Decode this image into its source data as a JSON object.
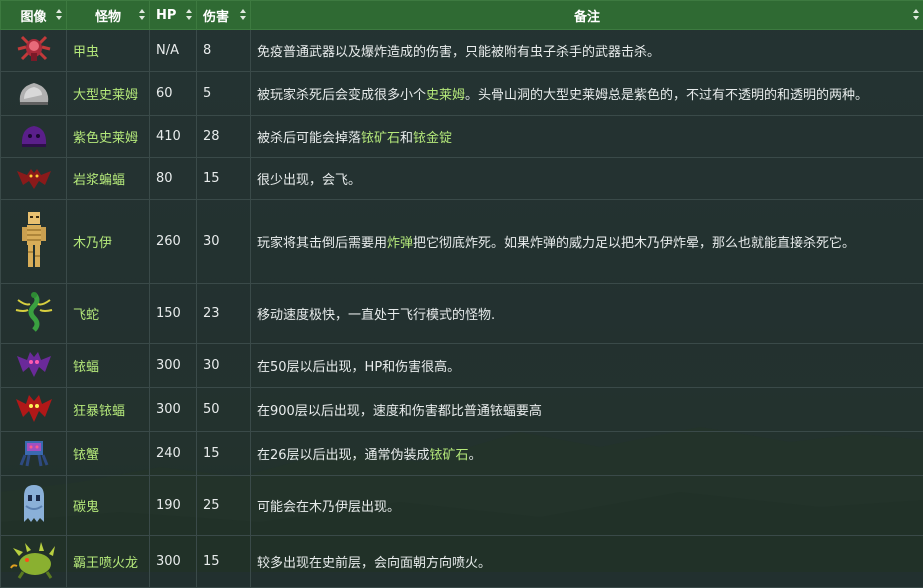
{
  "headers": {
    "image": "图像",
    "monster": "怪物",
    "hp": "HP",
    "damage": "伤害",
    "notes": "备注"
  },
  "rows": [
    {
      "name": "甲虫",
      "hp": "N/A",
      "damage": "8",
      "note": [
        {
          "t": "免疫普通武器以及爆炸造成的伤害，只能被附有虫子杀手的武器击杀。"
        }
      ]
    },
    {
      "name": "大型史莱姆",
      "hp": "60",
      "damage": "5",
      "note": [
        {
          "t": "被玩家杀死后会变成很多小个"
        },
        {
          "t": "史莱姆",
          "link": true
        },
        {
          "t": "。头骨山洞的大型史莱姆总是紫色的，不过有不透明的和透明的两种。"
        }
      ]
    },
    {
      "name": "紫色史莱姆",
      "hp": "410",
      "damage": "28",
      "note": [
        {
          "t": "被杀后可能会掉落"
        },
        {
          "t": "铱矿石",
          "link": true
        },
        {
          "t": "和"
        },
        {
          "t": "铱金锭",
          "link": true
        }
      ]
    },
    {
      "name": "岩浆蝙蝠",
      "hp": "80",
      "damage": "15",
      "note": [
        {
          "t": "很少出现，会飞。"
        }
      ]
    },
    {
      "name": "木乃伊",
      "hp": "260",
      "damage": "30",
      "note": [
        {
          "t": "玩家将其击倒后需要用"
        },
        {
          "t": "炸弹",
          "link": true
        },
        {
          "t": "把它彻底炸死。如果炸弹的威力足以把木乃伊炸晕，那么也就能直接杀死它。"
        }
      ]
    },
    {
      "name": "飞蛇",
      "hp": "150",
      "damage": "23",
      "note": [
        {
          "t": "移动速度极快，一直处于飞行模式的怪物."
        }
      ]
    },
    {
      "name": "铱蝠",
      "hp": "300",
      "damage": "30",
      "note": [
        {
          "t": "在50层以后出现，HP和伤害很高。"
        }
      ]
    },
    {
      "name": "狂暴铱蝠",
      "hp": "300",
      "damage": "50",
      "note": [
        {
          "t": "在900层以后出现，速度和伤害都比普通铱蝠要高"
        }
      ]
    },
    {
      "name": "铱蟹",
      "hp": "240",
      "damage": "15",
      "note": [
        {
          "t": "在26层以后出现，通常伪装成"
        },
        {
          "t": "铱矿石",
          "link": true
        },
        {
          "t": "。"
        }
      ]
    },
    {
      "name": "碳鬼",
      "hp": "190",
      "damage": "25",
      "note": [
        {
          "t": "可能会在木乃伊层出现。"
        }
      ]
    },
    {
      "name": "霸王喷火龙",
      "hp": "300",
      "damage": "15",
      "note": [
        {
          "t": "较多出现在史前层，会向面朝方向喷火。"
        }
      ]
    }
  ],
  "icons": [
    "beetle-icon",
    "big-slime-icon",
    "purple-slime-icon",
    "lava-bat-icon",
    "mummy-icon",
    "serpent-icon",
    "iridium-bat-icon",
    "haunted-bat-icon",
    "iridium-crab-icon",
    "carbon-ghost-icon",
    "pepper-rex-icon"
  ],
  "colors": {
    "header_bg": "#2f6a33",
    "link": "#b4e87a",
    "text": "#e8ecec"
  }
}
